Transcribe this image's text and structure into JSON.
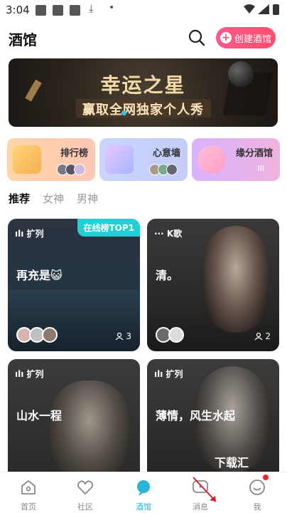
{
  "status_bar": {
    "time": "3:04"
  },
  "header": {
    "title": "酒馆",
    "create_label": "创建酒馆"
  },
  "banner": {
    "title": "幸运之星",
    "subtitle": "赢取全网独家个人秀"
  },
  "categories": [
    {
      "label": "排行榜"
    },
    {
      "label": "心意墙"
    },
    {
      "label": "缘分酒馆",
      "count": "III"
    }
  ],
  "tabs": [
    "推荐",
    "女神",
    "男神"
  ],
  "active_tab": "推荐",
  "rooms": [
    {
      "tag": "ılı 扩列",
      "name": "再充是😺",
      "rank": "在线榜TOP1",
      "people": "3"
    },
    {
      "tag": "··· K歌",
      "name": "清。",
      "people": "2"
    },
    {
      "tag": "ılı 扩列",
      "name": "山水一程"
    },
    {
      "tag": "ılı 扩列",
      "name": "薄情，风生水起"
    }
  ],
  "watermark": "下载汇",
  "tabbar": [
    {
      "label": "首页",
      "icon": "home-icon"
    },
    {
      "label": "社区",
      "icon": "heart-icon"
    },
    {
      "label": "酒馆",
      "icon": "bar-icon"
    },
    {
      "label": "消息",
      "icon": "message-icon"
    },
    {
      "label": "我",
      "icon": "profile-icon"
    }
  ],
  "colors": {
    "accent": "#2ab2d8",
    "create_button": "#ff4d6d",
    "rank_badge": "#1fd1d6"
  }
}
